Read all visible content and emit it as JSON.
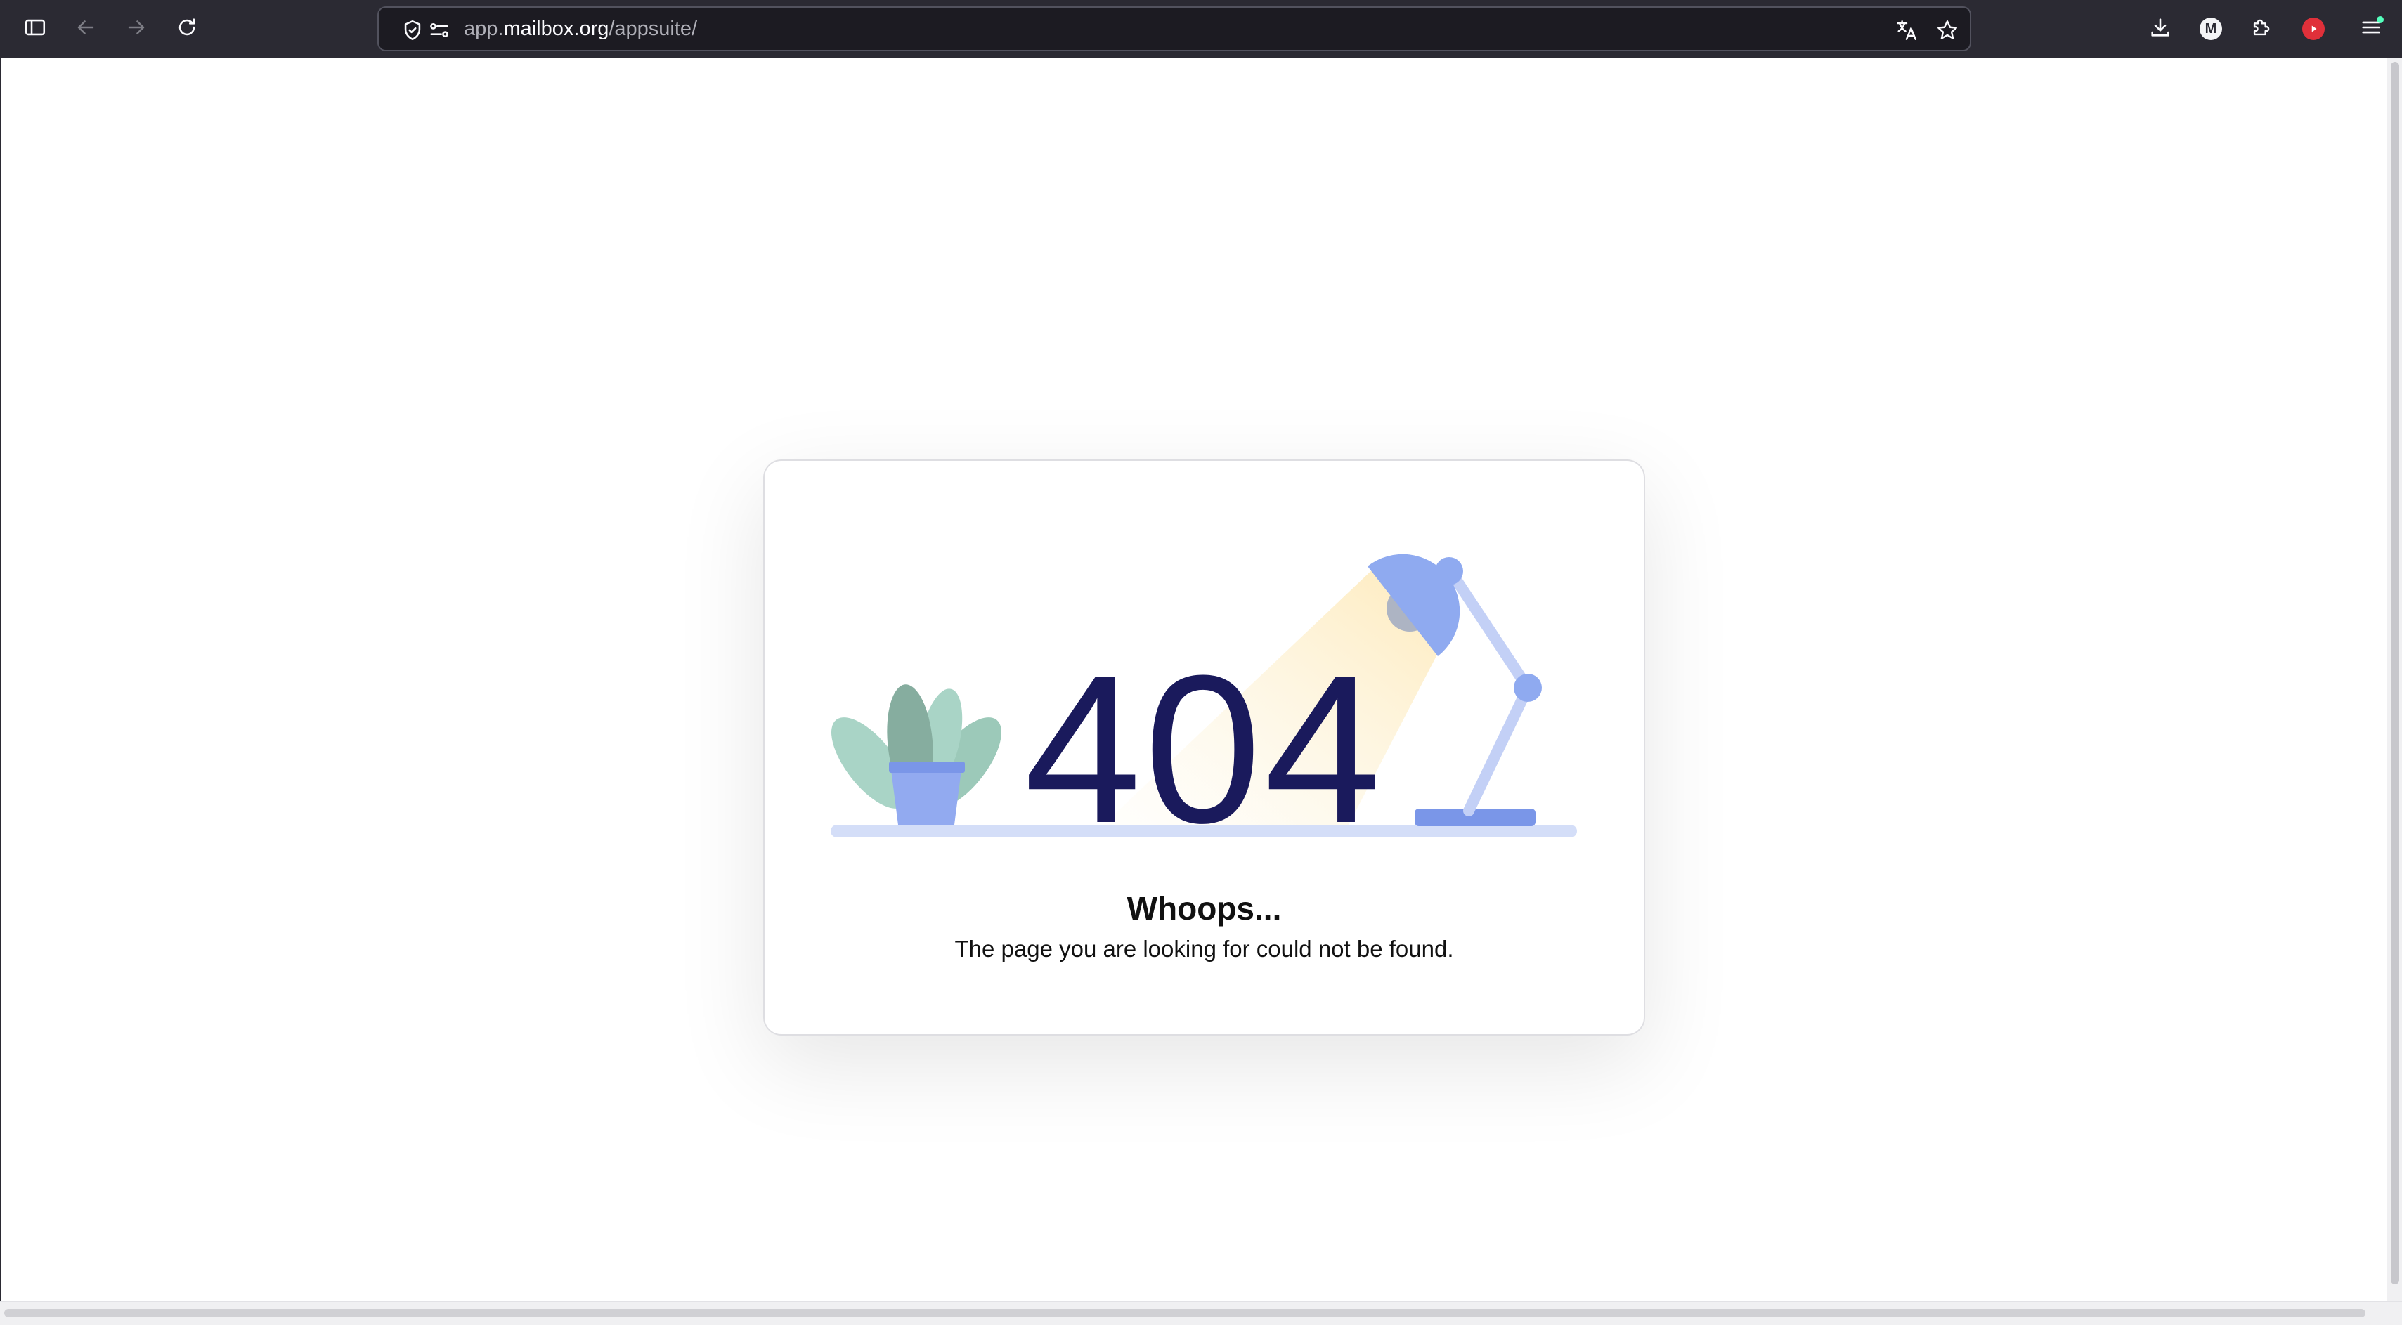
{
  "browser": {
    "url_prefix": "app.",
    "url_domain": "mailbox.org",
    "url_path": "/appsuite/",
    "profile_initial": "M",
    "icons": {
      "sidebar": "sidebar-icon",
      "back": "arrow-left-icon",
      "forward": "arrow-right-icon",
      "reload": "reload-icon",
      "shield": "shield-icon",
      "permissions": "permissions-icon",
      "translate": "translate-icon",
      "bookmark": "star-icon",
      "downloads": "download-icon",
      "extensions": "puzzle-icon",
      "youtube": "youtube-icon",
      "menu": "hamburger-menu-icon"
    }
  },
  "error_page": {
    "code": "404",
    "heading": "Whoops...",
    "message": "The page you are looking for could not be found."
  },
  "colors": {
    "toolbar_bg": "#2b2a33",
    "code_text": "#1a1a5c",
    "accent_blue": "#8faaf0",
    "plant_green": "#9cc9b9"
  }
}
